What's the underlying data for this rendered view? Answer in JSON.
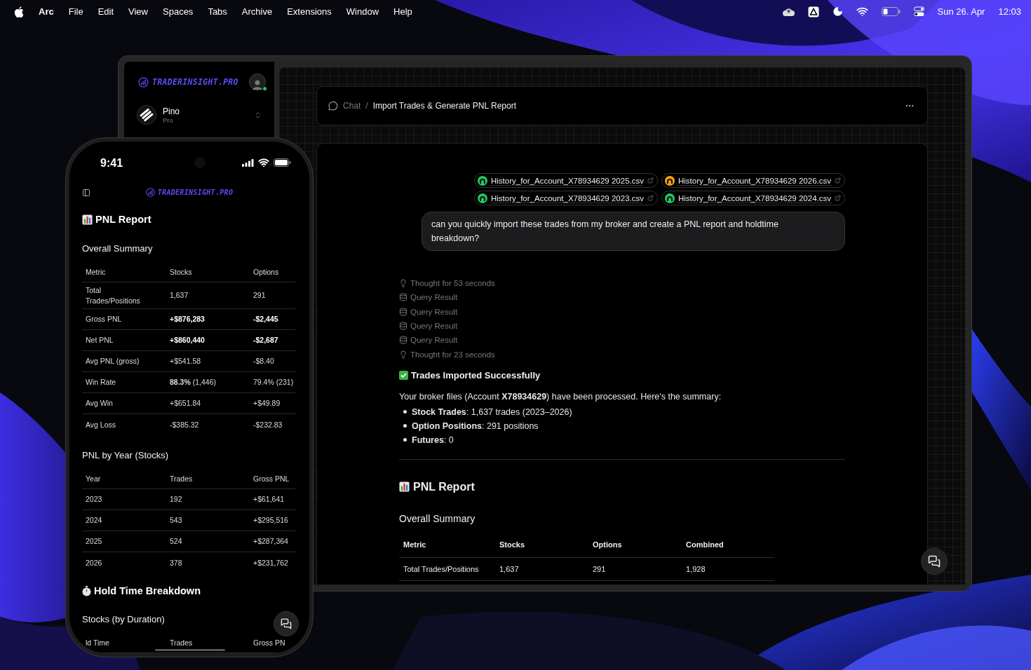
{
  "menu_bar": {
    "app": "Arc",
    "menus": [
      "File",
      "Edit",
      "View",
      "Spaces",
      "Tabs",
      "Archive",
      "Extensions",
      "Window",
      "Help"
    ],
    "date": "Sun 26. Apr",
    "time": "12:03"
  },
  "sidebar": {
    "logo": "TRADERINSIGHT.PRO",
    "user_online": true,
    "workspace": {
      "name": "Pino",
      "plan": "Pro"
    }
  },
  "breadcrumb": {
    "section": "Chat",
    "separator": "/",
    "title": "Import Trades & Generate PNL Report"
  },
  "attachments": [
    {
      "name": "History_for_Account_X78934629 2025.csv",
      "color": "#22c55e"
    },
    {
      "name": "History_for_Account_X78934629 2026.csv",
      "color": "#f59e0b"
    },
    {
      "name": "History_for_Account_X78934629 2023.csv",
      "color": "#22c55e"
    },
    {
      "name": "History_for_Account_X78934629 2024.csv",
      "color": "#22c55e"
    }
  ],
  "user_message": "can you quickly import these trades from my broker and create a PNL report and holdtime breakdown?",
  "steps": [
    {
      "kind": "thought",
      "text": "Thought for 53 seconds"
    },
    {
      "kind": "query",
      "text": "Query Result"
    },
    {
      "kind": "query",
      "text": "Query Result"
    },
    {
      "kind": "query",
      "text": "Query Result"
    },
    {
      "kind": "query",
      "text": "Query Result"
    },
    {
      "kind": "thought",
      "text": "Thought for 23 seconds"
    }
  ],
  "response": {
    "heading": "Trades Imported Successfully",
    "summary": "Your broker files (Account **X78934629**) have been processed. Here's the summary:",
    "bullets": [
      "**Stock Trades**: 1,637 trades (2023–2026)",
      "**Option Positions**: 291 positions",
      "**Futures**: 0"
    ],
    "report_title": "PNL Report",
    "section": "Overall Summary",
    "table": {
      "columns": [
        "Metric",
        "Stocks",
        "Options",
        "Combined"
      ],
      "rows": [
        [
          "Total Trades/Positions",
          "1,637",
          "291",
          "1,928"
        ]
      ]
    }
  },
  "phone": {
    "time": "9:41",
    "logo": "TRADERINSIGHT.PRO",
    "report_title": "PNL Report",
    "overall": {
      "title": "Overall Summary",
      "columns": [
        "Metric",
        "Stocks",
        "Options"
      ],
      "rows": [
        {
          "cells": [
            "Total Trades/Positions",
            "1,637",
            "291"
          ],
          "bold": false
        },
        {
          "cells": [
            "Gross PNL",
            "+$876,283",
            "-$2,445"
          ],
          "bold": true
        },
        {
          "cells": [
            "Net PNL",
            "+$860,440",
            "-$2,687"
          ],
          "bold": true
        },
        {
          "cells": [
            "Avg PNL (gross)",
            "+$541.58",
            "-$8.40"
          ],
          "bold": false
        },
        {
          "cells": [
            "Win Rate",
            "**88.3%** (1,446)",
            "79.4% (231)"
          ],
          "bold": false
        },
        {
          "cells": [
            "Avg Win",
            "+$651.84",
            "+$49.89"
          ],
          "bold": false
        },
        {
          "cells": [
            "Avg Loss",
            "-$385.32",
            "-$232.83"
          ],
          "bold": false
        }
      ]
    },
    "by_year": {
      "title": "PNL by Year (Stocks)",
      "columns": [
        "Year",
        "Trades",
        "Gross PNL"
      ],
      "rows": [
        {
          "cells": [
            "2023",
            "192",
            "+$61,641"
          ],
          "bold": false
        },
        {
          "cells": [
            "2024",
            "543",
            "+$295,516"
          ],
          "bold": false
        },
        {
          "cells": [
            "2025",
            "524",
            "+$287,364"
          ],
          "bold": false
        },
        {
          "cells": [
            "2026",
            "378",
            "+$231,762"
          ],
          "bold": false
        }
      ]
    },
    "hold_title": "Hold Time Breakdown",
    "hold_section": {
      "title": "Stocks (by Duration)",
      "columns": [
        "ld Time",
        "Trades",
        "Gross PN"
      ]
    }
  }
}
